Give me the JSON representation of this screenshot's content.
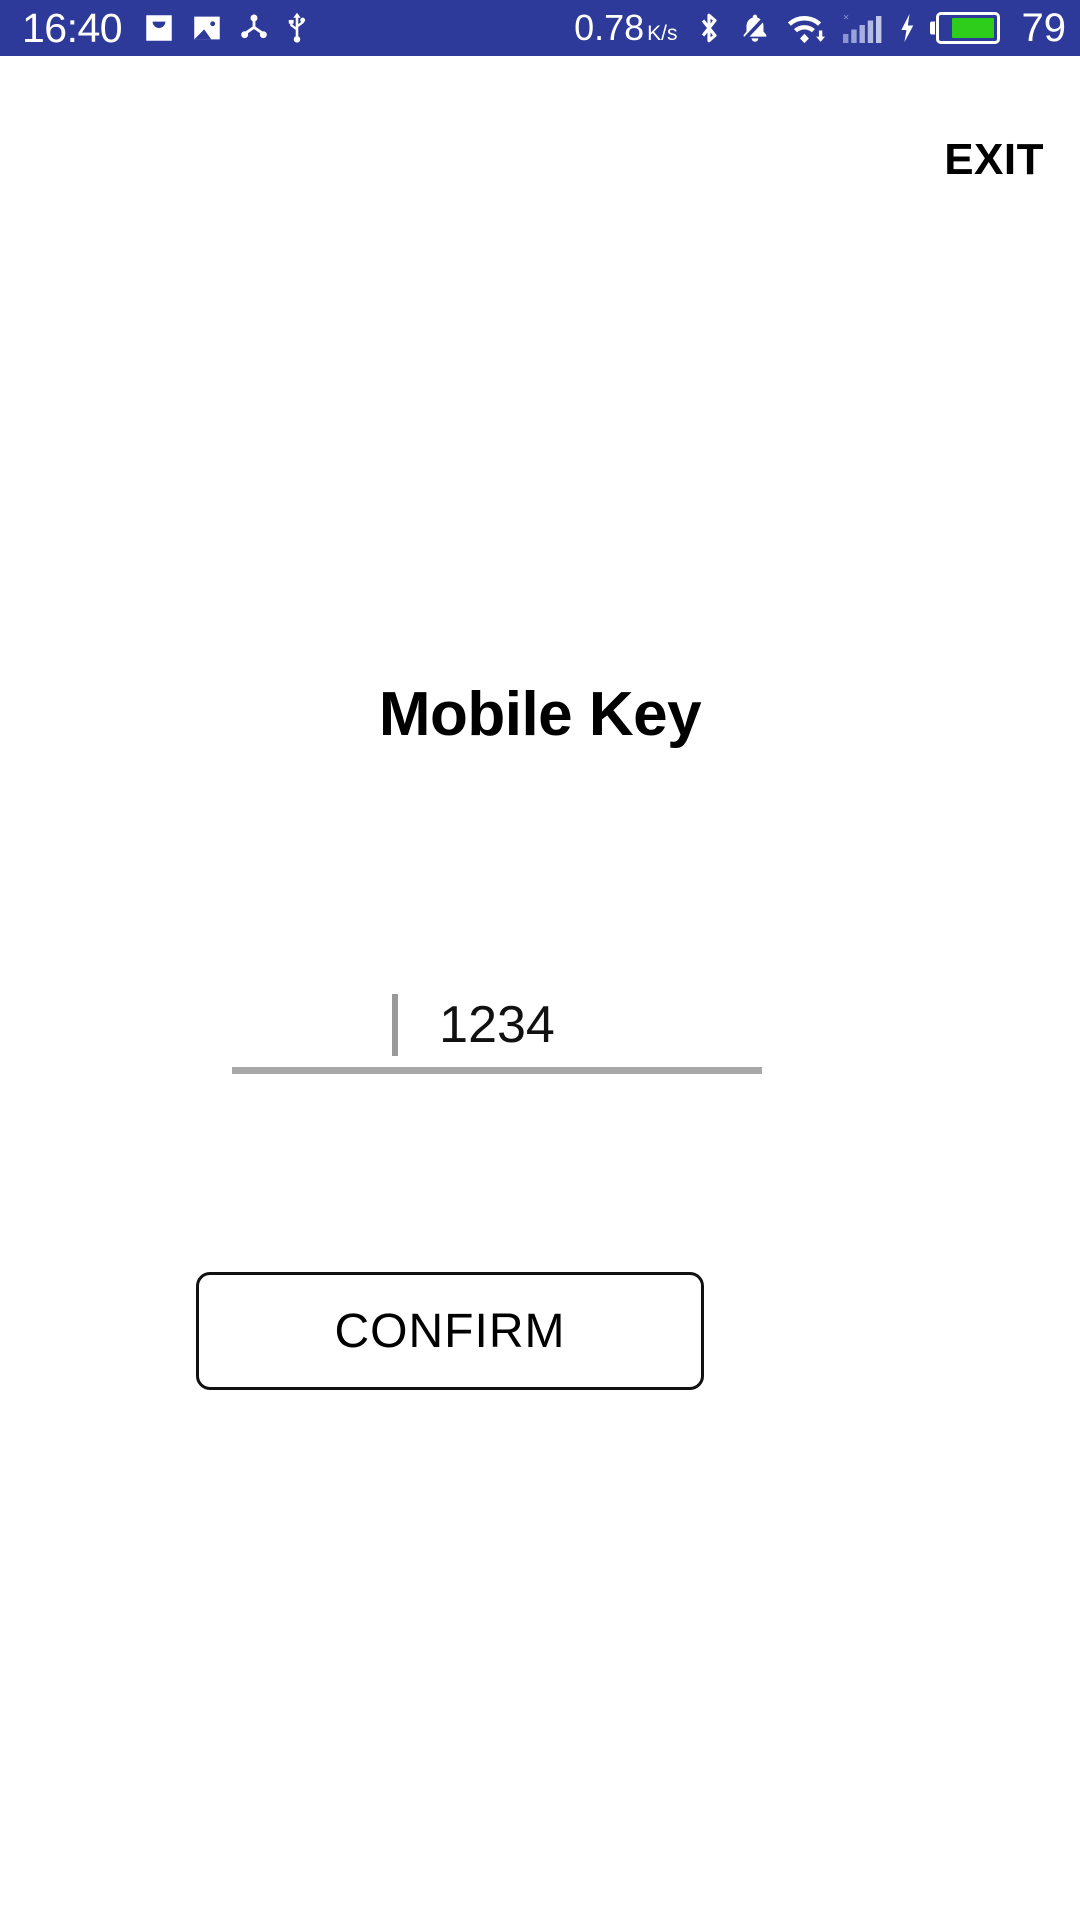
{
  "status_bar": {
    "background_color": "#2e3a9a",
    "clock": "16:40",
    "network_speed_value": "0.78",
    "network_speed_unit": "K/s",
    "battery_percent": "79",
    "battery_fill_color": "#2ecc1b",
    "icons": [
      {
        "name": "inbox-icon",
        "label": "inbox"
      },
      {
        "name": "image-icon",
        "label": "screenshot"
      },
      {
        "name": "share-icon",
        "label": "share"
      },
      {
        "name": "usb-icon",
        "label": "usb"
      },
      {
        "name": "bluetooth-icon",
        "label": "bluetooth"
      },
      {
        "name": "bell-muted-icon",
        "label": "silent"
      },
      {
        "name": "wifi-download-icon",
        "label": "wifi"
      },
      {
        "name": "signal-bars-icon",
        "label": "cellular signal"
      },
      {
        "name": "charging-bolt-icon",
        "label": "charging"
      },
      {
        "name": "battery-icon",
        "label": "battery"
      }
    ]
  },
  "screen": {
    "exit_label": "EXIT",
    "title": "Mobile Key",
    "input": {
      "value": "1234",
      "placeholder": ""
    },
    "confirm_label": "CONFIRM"
  }
}
